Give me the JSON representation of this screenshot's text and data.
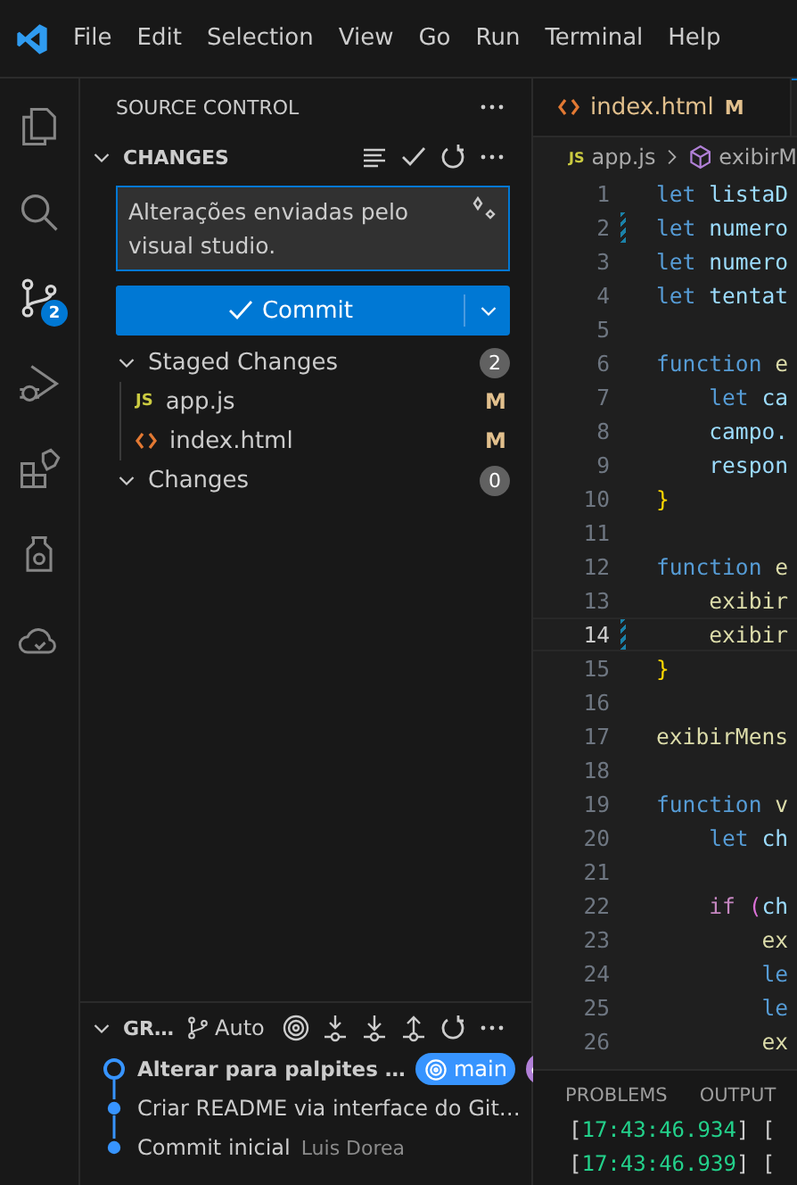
{
  "menu": [
    "File",
    "Edit",
    "Selection",
    "View",
    "Go",
    "Run",
    "Terminal",
    "Help"
  ],
  "activity_bar": [
    {
      "selected": false
    },
    {
      "selected": false
    },
    {
      "selected": true,
      "badge": "2"
    },
    {
      "selected": false
    },
    {
      "selected": false
    },
    {
      "selected": false
    },
    {
      "selected": false
    }
  ],
  "sidebar": {
    "title": "SOURCE CONTROL",
    "section": "CHANGES",
    "commit_message": "Alterações enviadas pelo visual studio.",
    "commit_button": "Commit",
    "groups": [
      {
        "label": "Staged Changes",
        "count": "2",
        "expanded": true,
        "files": [
          {
            "name": "app.js",
            "icon_text": "JS",
            "status": "M"
          },
          {
            "name": "index.html",
            "status": "M"
          }
        ]
      },
      {
        "label": "Changes",
        "count": "0",
        "expanded": true
      }
    ],
    "graph": {
      "title": "GR…",
      "auto": "Auto",
      "commits": [
        {
          "message": "Alterar para palpites …",
          "bold": true,
          "head": true,
          "branch": "main"
        },
        {
          "message": "Criar README via interface do Git…",
          "bold": false,
          "head": false
        },
        {
          "message": "Commit inicial",
          "bold": false,
          "head": false,
          "author": "Luis Dorea"
        }
      ]
    }
  },
  "editor": {
    "tab": {
      "name": "index.html",
      "status": "M"
    },
    "breadcrumb": {
      "icon_text": "JS",
      "file": "app.js",
      "symbol": "exibirM"
    },
    "lines": [
      {
        "n": "1",
        "modified": false,
        "current": false,
        "tokens": [
          {
            "text": "let ",
            "color": "#569cd6"
          },
          {
            "text": "listaD",
            "color": "#9cdcfe"
          }
        ]
      },
      {
        "n": "2",
        "modified": true,
        "current": false,
        "tokens": [
          {
            "text": "let ",
            "color": "#569cd6"
          },
          {
            "text": "numero",
            "color": "#9cdcfe"
          }
        ]
      },
      {
        "n": "3",
        "modified": false,
        "current": false,
        "tokens": [
          {
            "text": "let ",
            "color": "#569cd6"
          },
          {
            "text": "numero",
            "color": "#9cdcfe"
          }
        ]
      },
      {
        "n": "4",
        "modified": false,
        "current": false,
        "tokens": [
          {
            "text": "let ",
            "color": "#569cd6"
          },
          {
            "text": "tentat",
            "color": "#9cdcfe"
          }
        ]
      },
      {
        "n": "5",
        "modified": false,
        "current": false
      },
      {
        "n": "6",
        "modified": false,
        "current": false,
        "tokens": [
          {
            "text": "function ",
            "color": "#569cd6"
          },
          {
            "text": "e",
            "color": "#dcdcaa"
          }
        ]
      },
      {
        "n": "7",
        "modified": false,
        "current": false,
        "tokens": [
          {
            "text": "    let ",
            "color": "#569cd6"
          },
          {
            "text": "ca",
            "color": "#9cdcfe"
          }
        ]
      },
      {
        "n": "8",
        "modified": false,
        "current": false,
        "tokens": [
          {
            "text": "    campo.",
            "color": "#9cdcfe"
          }
        ]
      },
      {
        "n": "9",
        "modified": false,
        "current": false,
        "tokens": [
          {
            "text": "    respon",
            "color": "#9cdcfe"
          }
        ]
      },
      {
        "n": "10",
        "modified": false,
        "current": false,
        "tokens": [
          {
            "text": "}",
            "color": "#ffd700"
          }
        ]
      },
      {
        "n": "11",
        "modified": false,
        "current": false
      },
      {
        "n": "12",
        "modified": false,
        "current": false,
        "tokens": [
          {
            "text": "function ",
            "color": "#569cd6"
          },
          {
            "text": "e",
            "color": "#dcdcaa"
          }
        ]
      },
      {
        "n": "13",
        "modified": false,
        "current": false,
        "tokens": [
          {
            "text": "    exibir",
            "color": "#dcdcaa"
          }
        ]
      },
      {
        "n": "14",
        "modified": true,
        "current": true,
        "tokens": [
          {
            "text": "    exibir",
            "color": "#dcdcaa"
          }
        ]
      },
      {
        "n": "15",
        "modified": false,
        "current": false,
        "tokens": [
          {
            "text": "}",
            "color": "#ffd700"
          }
        ]
      },
      {
        "n": "16",
        "modified": false,
        "current": false
      },
      {
        "n": "17",
        "modified": false,
        "current": false,
        "tokens": [
          {
            "text": "exibirMens",
            "color": "#dcdcaa"
          }
        ]
      },
      {
        "n": "18",
        "modified": false,
        "current": false
      },
      {
        "n": "19",
        "modified": false,
        "current": false,
        "tokens": [
          {
            "text": "function ",
            "color": "#569cd6"
          },
          {
            "text": "v",
            "color": "#dcdcaa"
          }
        ]
      },
      {
        "n": "20",
        "modified": false,
        "current": false,
        "tokens": [
          {
            "text": "    let ",
            "color": "#569cd6"
          },
          {
            "text": "ch",
            "color": "#9cdcfe"
          }
        ]
      },
      {
        "n": "21",
        "modified": false,
        "current": false
      },
      {
        "n": "22",
        "modified": false,
        "current": false,
        "tokens": [
          {
            "text": "    if ",
            "color": "#c586c0"
          },
          {
            "text": "(",
            "color": "#da70d6"
          },
          {
            "text": "ch",
            "color": "#9cdcfe"
          }
        ]
      },
      {
        "n": "23",
        "modified": false,
        "current": false,
        "tokens": [
          {
            "text": "        ex",
            "color": "#dcdcaa"
          }
        ]
      },
      {
        "n": "24",
        "modified": false,
        "current": false,
        "tokens": [
          {
            "text": "        le",
            "color": "#569cd6"
          }
        ]
      },
      {
        "n": "25",
        "modified": false,
        "current": false,
        "tokens": [
          {
            "text": "        le",
            "color": "#569cd6"
          }
        ]
      },
      {
        "n": "26",
        "modified": false,
        "current": false,
        "tokens": [
          {
            "text": "        ex",
            "color": "#dcdcaa"
          }
        ]
      }
    ]
  },
  "panel": {
    "tabs": [
      "PROBLEMS",
      "OUTPUT"
    ],
    "lines": [
      {
        "parts": [
          {
            "text": "[",
            "color": "#cccccc"
          },
          {
            "text": "17:43:46.934",
            "color": "#23d18b"
          },
          {
            "text": "] [",
            "color": "#cccccc"
          }
        ]
      },
      {
        "parts": [
          {
            "text": "[",
            "color": "#cccccc"
          },
          {
            "text": "17:43:46.939",
            "color": "#23d18b"
          },
          {
            "text": "] [",
            "color": "#cccccc"
          }
        ]
      }
    ]
  }
}
